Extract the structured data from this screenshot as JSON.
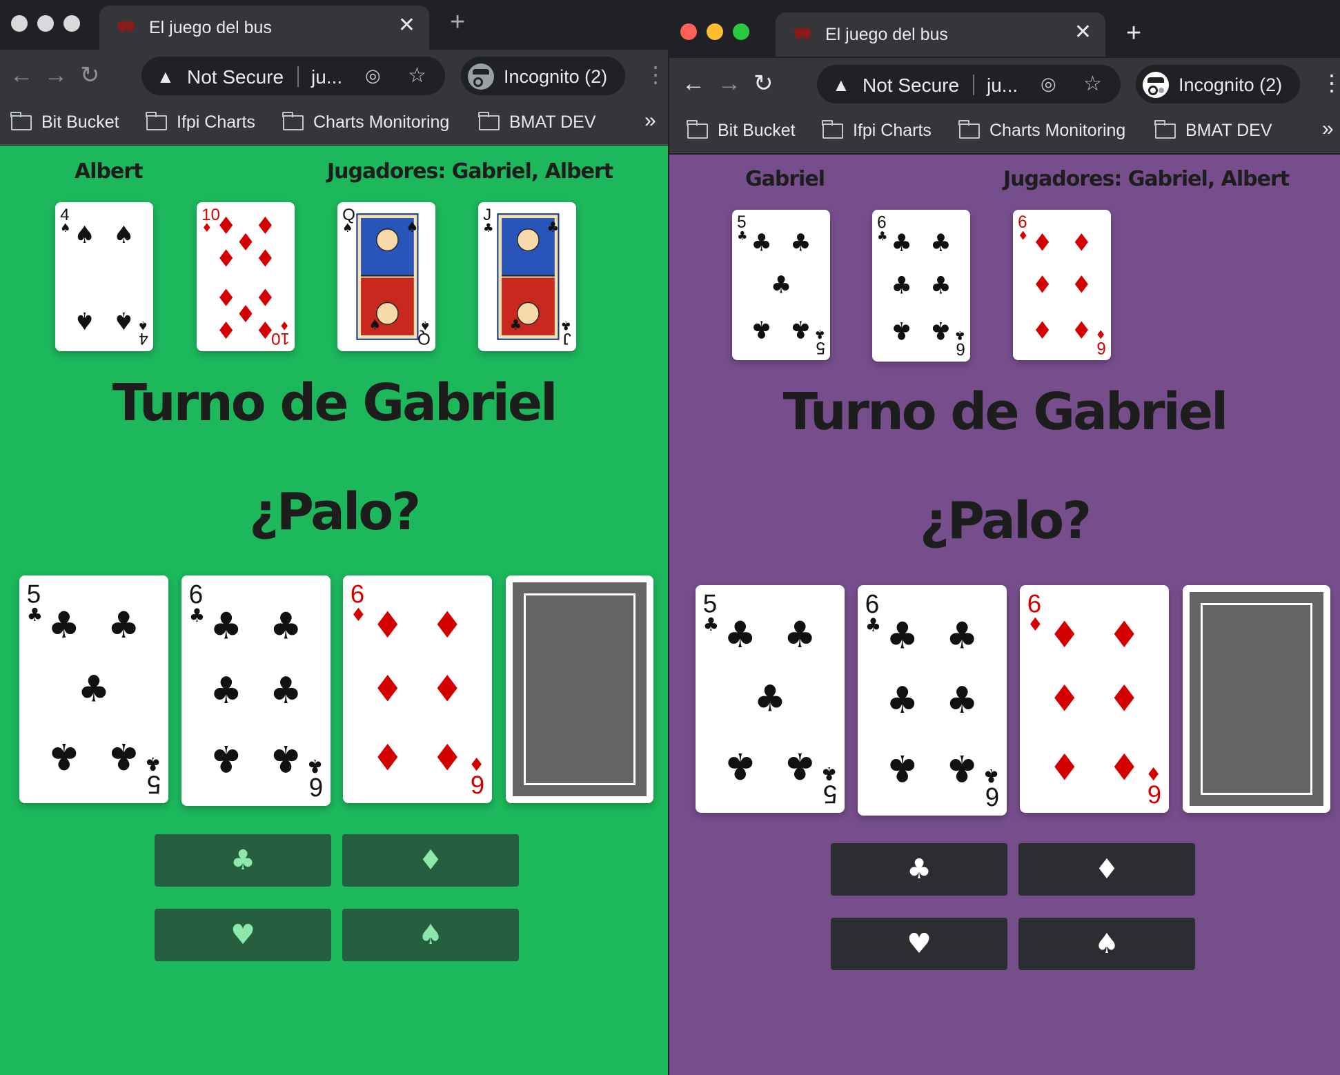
{
  "browser": {
    "tab_title": "El juego del bus",
    "tab_close": "✕",
    "new_tab": "+",
    "security_label": "Not Secure",
    "url": "ju...",
    "incognito_label": "Incognito (2)",
    "bookmarks": [
      "Bit Bucket",
      "Ifpi Charts",
      "Charts Monitoring",
      "BMAT DEV"
    ],
    "bookmarks_overflow": "»"
  },
  "left_window": {
    "page_bg": "#1db75c",
    "player_name": "Albert",
    "players_label": "Jugadores: Gabriel, Albert",
    "hand": [
      {
        "rank": "4",
        "suit": "spades"
      },
      {
        "rank": "10",
        "suit": "diamonds"
      },
      {
        "rank": "Q",
        "suit": "spades"
      },
      {
        "rank": "J",
        "suit": "clubs"
      }
    ],
    "turn_text": "Turno de Gabriel",
    "question": "¿Palo?",
    "board": [
      {
        "rank": "5",
        "suit": "clubs"
      },
      {
        "rank": "6",
        "suit": "clubs"
      },
      {
        "rank": "6",
        "suit": "diamonds"
      },
      {
        "rank": "back",
        "suit": "back"
      }
    ]
  },
  "right_window": {
    "page_bg": "#764e8c",
    "player_name": "Gabriel",
    "players_label": "Jugadores: Gabriel, Albert",
    "hand": [
      {
        "rank": "5",
        "suit": "clubs"
      },
      {
        "rank": "6",
        "suit": "clubs"
      },
      {
        "rank": "6",
        "suit": "diamonds"
      }
    ],
    "turn_text": "Turno de Gabriel",
    "question": "¿Palo?",
    "board": [
      {
        "rank": "5",
        "suit": "clubs"
      },
      {
        "rank": "6",
        "suit": "clubs"
      },
      {
        "rank": "6",
        "suit": "diamonds"
      },
      {
        "rank": "back",
        "suit": "back"
      }
    ]
  },
  "suit_buttons": [
    {
      "name": "clubs",
      "symbol": "♣"
    },
    {
      "name": "diamonds",
      "symbol": "♦"
    },
    {
      "name": "hearts",
      "symbol": "♥"
    },
    {
      "name": "spades",
      "symbol": "♠"
    }
  ],
  "colors": {
    "chrome_dark": "#202124",
    "chrome_toolbar": "#35363a",
    "card_red": "#d40000",
    "card_black": "#111111"
  }
}
